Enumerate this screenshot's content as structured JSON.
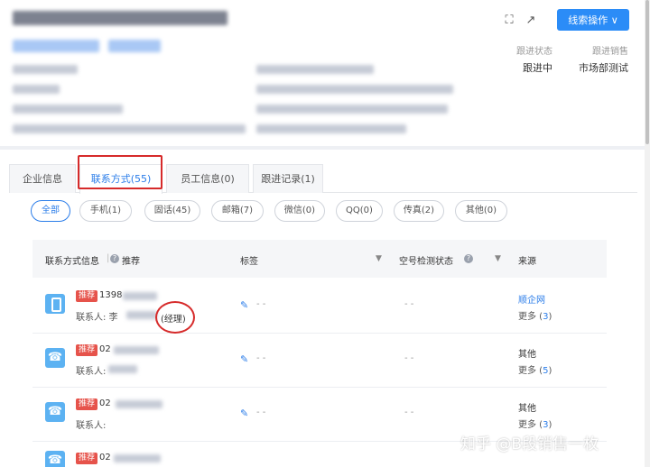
{
  "header": {
    "lead_button": "线索操作 ∨",
    "follow_status": {
      "label": "跟进状态",
      "value": "跟进中"
    },
    "follow_sales": {
      "label": "跟进销售",
      "value": "市场部测试"
    },
    "icons": {
      "fullscreen": "fullscreen-icon",
      "open": "external-link-icon"
    }
  },
  "tabs": [
    {
      "label": "企业信息"
    },
    {
      "label": "联系方式(55)",
      "active": true
    },
    {
      "label": "员工信息(0)"
    },
    {
      "label": "跟进记录(1)"
    }
  ],
  "filters": [
    {
      "label": "全部",
      "active": true
    },
    {
      "label": "手机(1)"
    },
    {
      "label": "固话(45)"
    },
    {
      "label": "邮箱(7)"
    },
    {
      "label": "微信(0)"
    },
    {
      "label": "QQ(0)"
    },
    {
      "label": "传真(2)"
    },
    {
      "label": "其他(0)"
    }
  ],
  "table": {
    "headers": {
      "contact_info": "联系方式信息",
      "recommend": "推荐",
      "tags": "标签",
      "empty_check": "空号检测状态",
      "source": "来源"
    },
    "rows": [
      {
        "badge": "推荐",
        "number_prefix": "1398",
        "contact_label": "联系人: 李",
        "job": "(经理)",
        "tag": "- -",
        "empty_status": "- -",
        "source": "顺企网",
        "more_label": "更多 (",
        "more_count": "3",
        "more_close": ")"
      },
      {
        "badge": "推荐",
        "number_prefix": "02",
        "contact_label": "联系人:",
        "tag": "- -",
        "empty_status": "- -",
        "source": "其他",
        "more_label": "更多 (",
        "more_count": "5",
        "more_close": ")"
      },
      {
        "badge": "推荐",
        "number_prefix": "02",
        "contact_label": "联系人:",
        "tag": "- -",
        "empty_status": "- -",
        "source": "其他",
        "more_label": "更多 (",
        "more_count": "3",
        "more_close": ")"
      },
      {
        "badge": "推荐",
        "number_prefix": "02",
        "contact_label": "",
        "tag": "",
        "empty_status": "",
        "source": "",
        "more_label": "",
        "more_count": "",
        "more_close": ""
      }
    ]
  },
  "watermark": "知乎 @B段销售一枚",
  "colors": {
    "accent": "#2b8cf7",
    "badge": "#e6534b",
    "highlight": "#d62a2a"
  }
}
